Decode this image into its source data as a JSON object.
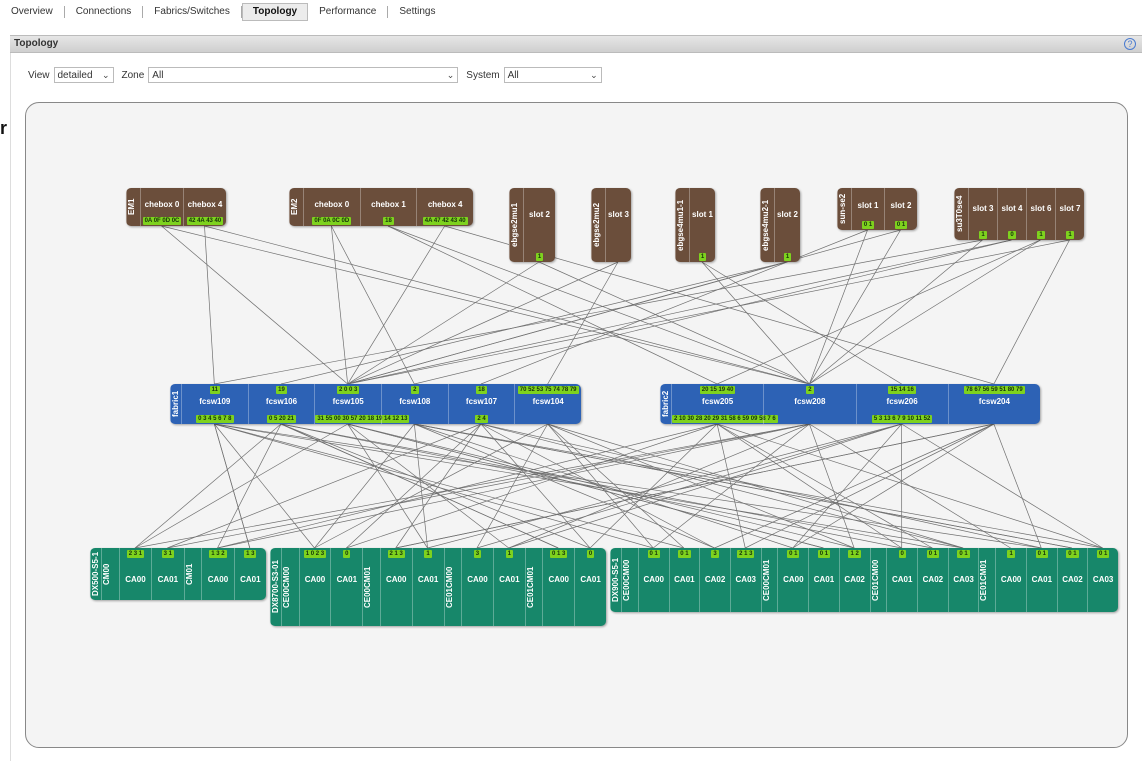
{
  "tabs": [
    "Overview",
    "Connections",
    "Fabrics/Switches",
    "Topology",
    "Performance",
    "Settings"
  ],
  "active_tab": "Topology",
  "panel": {
    "title": "Topology",
    "help": "?"
  },
  "stray_text": "r",
  "filters": {
    "view_label": "View",
    "view_value": "detailed",
    "zone_label": "Zone",
    "zone_value": "All",
    "system_label": "System",
    "system_value": "All"
  },
  "top_nodes": [
    {
      "id": "EM1",
      "cells": [
        {
          "name": "chebox 0",
          "ports": "0A 0F 0D 0C"
        },
        {
          "name": "chebox 4",
          "ports": "42 4A 43 40"
        }
      ]
    },
    {
      "id": "EM2",
      "cells": [
        {
          "name": "chebox 0",
          "ports": "0F 0A 0C 0D"
        },
        {
          "name": "chebox 1",
          "ports": "18"
        },
        {
          "name": "chebox 4",
          "ports": "4A 47 42 43 40"
        }
      ]
    },
    {
      "id": "ebgse2mu1",
      "cells": [
        {
          "name": "slot 2",
          "ports": "1"
        }
      ]
    },
    {
      "id": "ebgse2mu2",
      "cells": [
        {
          "name": "slot 3",
          "ports": ""
        }
      ]
    },
    {
      "id": "ebgse4mu1-1",
      "cells": [
        {
          "name": "slot 1",
          "ports": "1"
        }
      ]
    },
    {
      "id": "ebgse4mu2-1",
      "cells": [
        {
          "name": "slot 2",
          "ports": "1"
        }
      ]
    },
    {
      "id": "sun-se2",
      "cells": [
        {
          "name": "slot 1",
          "ports": "0 1"
        },
        {
          "name": "slot 2",
          "ports": "0 1"
        }
      ]
    },
    {
      "id": "su3T0se4",
      "cells": [
        {
          "name": "slot 3",
          "ports": "1"
        },
        {
          "name": "slot 4",
          "ports": "0"
        },
        {
          "name": "slot 6",
          "ports": "1"
        },
        {
          "name": "slot 7",
          "ports": "1"
        }
      ]
    }
  ],
  "fabrics": [
    {
      "id": "fabric1",
      "cells": [
        {
          "name": "fcsw109",
          "top": "11",
          "bottom": "0 3 4 5 6 7 8"
        },
        {
          "name": "fcsw106",
          "top": "19",
          "bottom": "0 5 20 21"
        },
        {
          "name": "fcsw105",
          "top": "2 0 0 3",
          "bottom": "31 55 00 30 57 20 18 19 14 12 13"
        },
        {
          "name": "fcsw108",
          "top": "2",
          "bottom": ""
        },
        {
          "name": "fcsw107",
          "top": "18",
          "bottom": "2 4"
        },
        {
          "name": "fcsw104",
          "top": "70 52 53 75 74 78 79",
          "bottom": ""
        }
      ]
    },
    {
      "id": "fabric2",
      "cells": [
        {
          "name": "fcsw205",
          "top": "20 15 19 40",
          "bottom": "2 10 30 28 20 29 31 58 6 59 09 58 7 6"
        },
        {
          "name": "fcsw208",
          "top": "2",
          "bottom": ""
        },
        {
          "name": "fcsw206",
          "top": "15 14 16",
          "bottom": "5 3 13 6 7 9 10 11 52"
        },
        {
          "name": "fcsw204",
          "top": "78 67 56 59 51 80 79",
          "bottom": ""
        }
      ]
    }
  ],
  "storage": [
    {
      "id": "DX500-S5-1",
      "groups": [
        {
          "cm": "CM00",
          "cells": [
            {
              "name": "CA00",
              "ports": "2 3 1"
            },
            {
              "name": "CA01",
              "ports": "3 1"
            }
          ]
        },
        {
          "cm": "CM01",
          "cells": [
            {
              "name": "CA00",
              "ports": "1 3 2"
            },
            {
              "name": "CA01",
              "ports": "1 3"
            }
          ]
        }
      ]
    },
    {
      "id": "DX8700-S3-01",
      "groups": [
        {
          "cm": "CE00CM00",
          "cells": [
            {
              "name": "CA00",
              "ports": "1 0 2 3"
            },
            {
              "name": "CA01",
              "ports": "0"
            }
          ]
        },
        {
          "cm": "CE00CM01",
          "cells": [
            {
              "name": "CA00",
              "ports": "2 1 3"
            },
            {
              "name": "CA01",
              "ports": "1"
            }
          ]
        },
        {
          "cm": "CE01CM00",
          "cells": [
            {
              "name": "CA00",
              "ports": "3"
            },
            {
              "name": "CA01",
              "ports": "1"
            }
          ]
        },
        {
          "cm": "CE01CM01",
          "cells": [
            {
              "name": "CA00",
              "ports": "0 1 3"
            },
            {
              "name": "CA01",
              "ports": "0"
            }
          ]
        }
      ]
    },
    {
      "id": "DX900-S5-1",
      "groups": [
        {
          "cm": "CE00CM00",
          "cells": [
            {
              "name": "CA00",
              "ports": "0 1"
            },
            {
              "name": "CA01",
              "ports": "0 1"
            },
            {
              "name": "CA02",
              "ports": "3"
            },
            {
              "name": "CA03",
              "ports": "2 1 3"
            }
          ]
        },
        {
          "cm": "CE00CM01",
          "cells": [
            {
              "name": "CA00",
              "ports": "0 1"
            },
            {
              "name": "CA01",
              "ports": "0 1"
            },
            {
              "name": "CA02",
              "ports": "1 2"
            }
          ]
        },
        {
          "cm": "CE01CM00",
          "cells": [
            {
              "name": "CA01",
              "ports": "0"
            },
            {
              "name": "CA02",
              "ports": "0 1"
            },
            {
              "name": "CA03",
              "ports": "0 1"
            }
          ]
        },
        {
          "cm": "CE01CM01",
          "cells": [
            {
              "name": "CA00",
              "ports": "1"
            },
            {
              "name": "CA01",
              "ports": "0 1"
            },
            {
              "name": "CA02",
              "ports": "0 1"
            },
            {
              "name": "CA03",
              "ports": "0 1"
            }
          ]
        }
      ]
    }
  ],
  "colors": {
    "host": "#6b4e3b",
    "fabric": "#2d62b5",
    "storage": "#17876a",
    "port": "#7ed21e",
    "link": "#707070"
  }
}
